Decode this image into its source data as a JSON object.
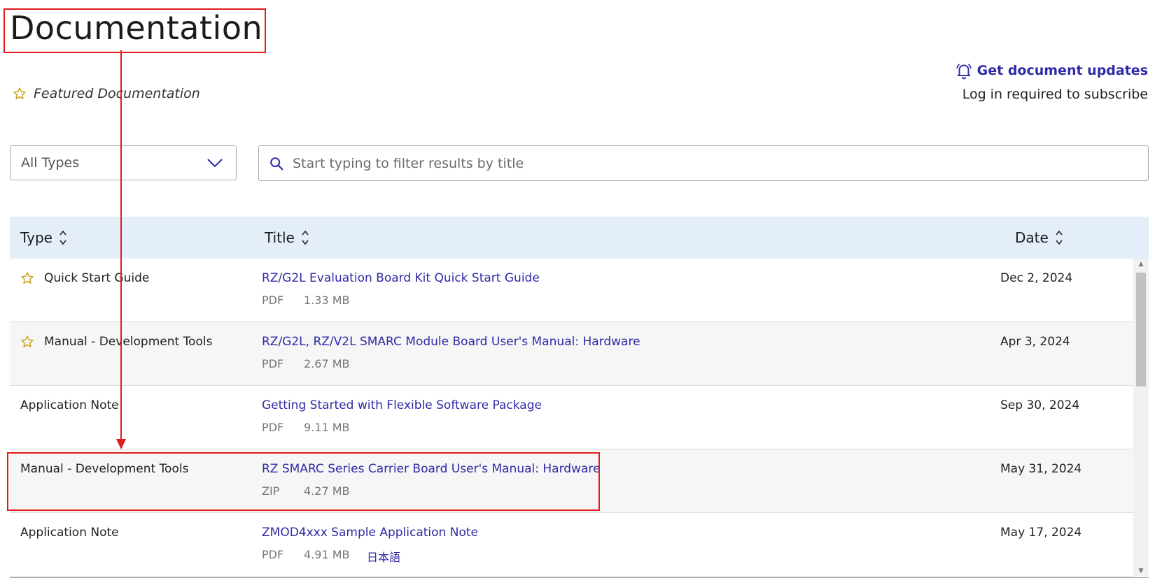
{
  "page": {
    "title": "Documentation"
  },
  "featured": {
    "label": "Featured Documentation",
    "icon": "star-outline-icon"
  },
  "updates": {
    "link_label": "Get document updates",
    "note": "Log in required to subscribe",
    "icon": "bell-icon"
  },
  "filters": {
    "type_select": {
      "value": "All Types",
      "icon": "chevron-down-icon"
    },
    "search": {
      "placeholder": "Start typing to filter results by title",
      "value": "",
      "icon": "search-icon"
    }
  },
  "table": {
    "columns": [
      {
        "label": "Type",
        "sort_icon": "sort-icon"
      },
      {
        "label": "Title",
        "sort_icon": "sort-icon"
      },
      {
        "label": "Date",
        "sort_icon": "sort-icon"
      }
    ],
    "rows": [
      {
        "featured": true,
        "type": "Quick Start Guide",
        "title": "RZ/G2L Evaluation Board Kit Quick Start Guide",
        "format": "PDF",
        "size": "1.33 MB",
        "lang": "",
        "date": "Dec 2, 2024"
      },
      {
        "featured": true,
        "type": "Manual - Development Tools",
        "title": "RZ/G2L, RZ/V2L SMARC Module Board User's Manual: Hardware",
        "format": "PDF",
        "size": "2.67 MB",
        "lang": "",
        "date": "Apr 3, 2024"
      },
      {
        "featured": false,
        "type": "Application Note",
        "title": "Getting Started with Flexible Software Package",
        "format": "PDF",
        "size": "9.11 MB",
        "lang": "",
        "date": "Sep 30, 2024"
      },
      {
        "featured": false,
        "type": "Manual - Development Tools",
        "title": "RZ SMARC Series Carrier Board User's Manual: Hardware",
        "format": "ZIP",
        "size": "4.27 MB",
        "lang": "",
        "date": "May 31, 2024"
      },
      {
        "featured": false,
        "type": "Application Note",
        "title": "ZMOD4xxx Sample Application Note",
        "format": "PDF",
        "size": "4.91 MB",
        "lang": "日本語",
        "date": "May 17, 2024"
      }
    ]
  },
  "colors": {
    "link": "#2f2aa5",
    "header_bg": "#e3eef8",
    "star": "#c9a227",
    "annotation": "#e11b1b"
  }
}
